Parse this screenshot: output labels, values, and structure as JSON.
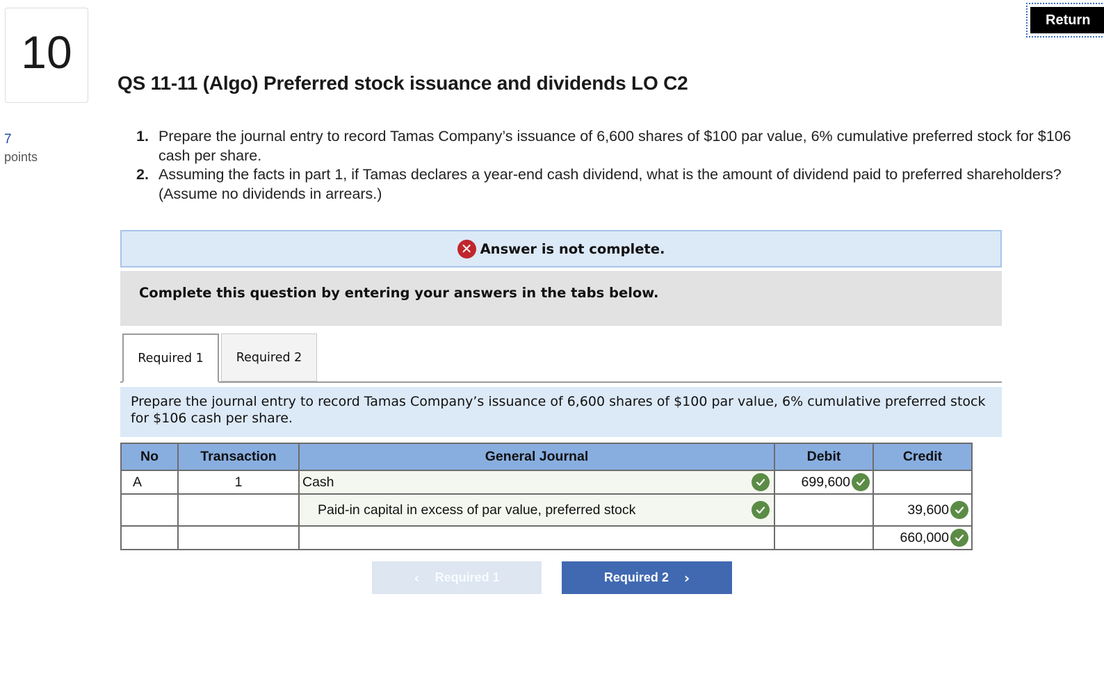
{
  "question": {
    "number": "10",
    "points_value": "7",
    "points_label": "points",
    "title": "QS 11-11 (Algo) Preferred stock issuance and dividends LO C2",
    "instructions": [
      {
        "num": "1.",
        "text": "Prepare the journal entry to record Tamas Company’s issuance of 6,600 shares of $100 par value, 6% cumulative preferred stock for $106 cash per share."
      },
      {
        "num": "2.",
        "text": "Assuming the facts in part 1, if Tamas declares a year-end cash dividend, what is the amount of dividend paid to preferred shareholders? (Assume no dividends in arrears.)"
      }
    ]
  },
  "header": {
    "return_label": "Return"
  },
  "alert": {
    "icon": "x-circle-icon",
    "text": "Answer is not complete.",
    "color": "#c0262d"
  },
  "instruction_box": {
    "text": "Complete this question by entering your answers in the tabs below."
  },
  "tabs": [
    {
      "label": "Required 1",
      "active": true
    },
    {
      "label": "Required 2",
      "active": false
    }
  ],
  "prompt": {
    "text": "Prepare the journal entry to record Tamas Company’s issuance of 6,600 shares of $100 par value, 6% cumulative preferred stock for $106 cash per share."
  },
  "journal": {
    "headers": [
      "No",
      "Transaction",
      "General Journal",
      "Debit",
      "Credit"
    ],
    "rows": [
      {
        "no": "A",
        "transaction": "1",
        "account": "Cash",
        "account_correct": true,
        "debit": "699,600",
        "debit_correct": true,
        "credit": "",
        "credit_correct": false
      },
      {
        "no": "",
        "transaction": "",
        "account": "Paid-in capital in excess of par value, preferred stock",
        "account_correct": true,
        "debit": "",
        "debit_correct": false,
        "credit": "39,600",
        "credit_correct": true
      },
      {
        "no": "",
        "transaction": "",
        "account": "",
        "account_correct": false,
        "debit": "",
        "debit_correct": false,
        "credit": "660,000",
        "credit_correct": true
      }
    ],
    "header_color": "#88aee0",
    "check_color": "#5b8c46"
  },
  "navigation": {
    "prev_label": "Required 1",
    "next_label": "Required 2",
    "prev_icon": "chevron-left-icon",
    "next_icon": "chevron-right-icon"
  }
}
